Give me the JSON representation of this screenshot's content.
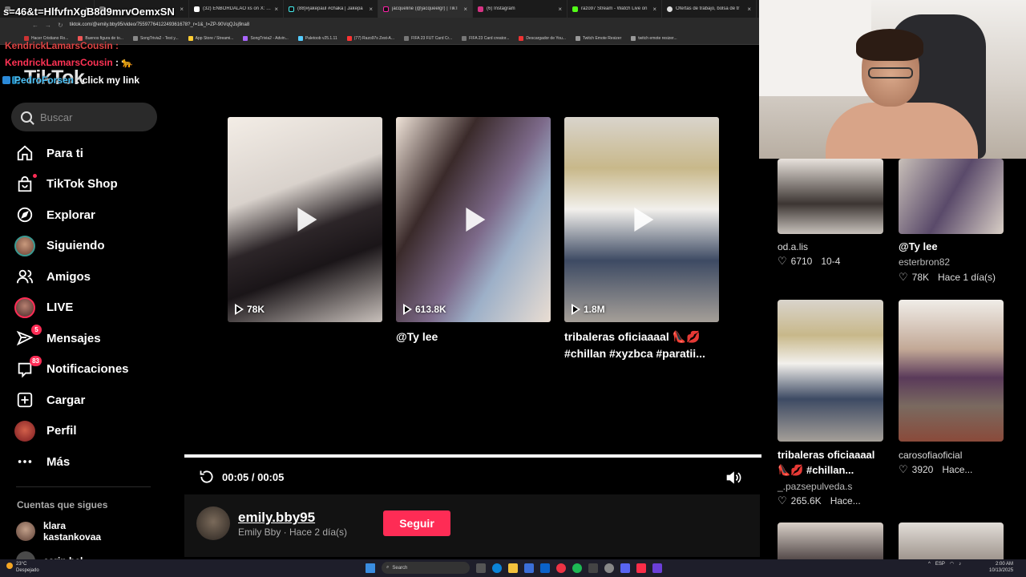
{
  "browser": {
    "tabs": [
      {
        "title": ""
      },
      {
        "title": ""
      },
      {
        "title": "(32) ENBORDALAO xs on X: \"G"
      },
      {
        "title": "(88)#jakepaul #chaka | Jakepa"
      },
      {
        "title": "jacqueline (@jacqueelgr) | TikT"
      },
      {
        "title": "(6) Instagram"
      },
      {
        "title": "razo97 Stream - Watch Live on"
      },
      {
        "title": "Ofertas de trabajo, bolsa de tr"
      }
    ],
    "url": "tiktok.com/@emily.bby95/video/7559776412249361678?_r=1&_t=ZP-90VqQJsj9na8",
    "bookmarks": [
      "Hacer Cristiano Ro...",
      "Buenos figura de to...",
      "SongTrivia2 - Test y...",
      "App Store / Streami...",
      "SongTrivia2 - Advin...",
      "Paletoob v25.1.11",
      "(77) Razo97s Zest-A...",
      "FIFA 23 FUT Card Cr...",
      "FIFA 23 Card creator...",
      "Descargador de You...",
      "Twitch Emote Resizer",
      "twitch emote resizer..."
    ]
  },
  "overlay": {
    "top_text": "s=46&t=HlfvfnXgB8d9mrvOemxSN",
    "chat": [
      {
        "name": "KendrickLamarsCousin",
        "sep": " : ",
        "msg": ""
      },
      {
        "name": "KendrickLamarsCousin",
        "sep": " : ",
        "msg": "🐆"
      },
      {
        "name": "PedroForsen",
        "sep": " : ",
        "msg": "click my link"
      }
    ],
    "logo_text": "TikTok"
  },
  "sidebar": {
    "search_placeholder": "Buscar",
    "nav": [
      {
        "label": "Para ti",
        "icon": "home-icon"
      },
      {
        "label": "TikTok Shop",
        "icon": "shop-icon"
      },
      {
        "label": "Explorar",
        "icon": "compass-icon"
      },
      {
        "label": "Siguiendo",
        "icon": "following-avatar-icon"
      },
      {
        "label": "Amigos",
        "icon": "friends-icon"
      },
      {
        "label": "LIVE",
        "icon": "live-avatar-icon"
      },
      {
        "label": "Mensajes",
        "icon": "messages-icon",
        "badge": "5"
      },
      {
        "label": "Notificaciones",
        "icon": "inbox-icon",
        "badge": "83"
      },
      {
        "label": "Cargar",
        "icon": "upload-icon"
      },
      {
        "label": "Perfil",
        "icon": "profile-avatar-icon"
      },
      {
        "label": "Más",
        "icon": "more-icon"
      }
    ],
    "following_title": "Cuentas que sigues",
    "following": [
      {
        "name": "klara kastankovaa"
      },
      {
        "name": "carin.bel"
      }
    ]
  },
  "videos": [
    {
      "views": "78K",
      "desc": ""
    },
    {
      "views": "613.8K",
      "desc": "@Ty lee"
    },
    {
      "views": "1.8M",
      "desc": "tribaleras oficiaaaal 👠💋 #chillan #xyzbca #paratii..."
    }
  ],
  "player": {
    "time": "00:05 / 00:05",
    "progress": 1.0
  },
  "author": {
    "username": "emily.bby95",
    "meta": "Emily Bby · Hace 2 día(s)",
    "follow_label": "Seguir"
  },
  "related": [
    {
      "user": "od.a.lis",
      "likes": "6710",
      "date": "10-4",
      "title": ""
    },
    {
      "title": "@Ty lee",
      "user": "esterbron82",
      "likes": "78K",
      "date": "Hace 1 día(s)"
    },
    {
      "title": "tribaleras oficiaaaal 👠💋 #chillan...",
      "user": "_.pazsepulveda.s",
      "likes": "265.6K",
      "date": "Hace..."
    },
    {
      "title": "",
      "user": "carosofiaoficial",
      "likes": "3920",
      "date": "Hace..."
    }
  ],
  "taskbar": {
    "weather_temp": "23°C",
    "weather_desc": "Despejado",
    "search": "Search",
    "lang": "ESP",
    "time": "2:00 AM",
    "date": "10/13/2025"
  }
}
